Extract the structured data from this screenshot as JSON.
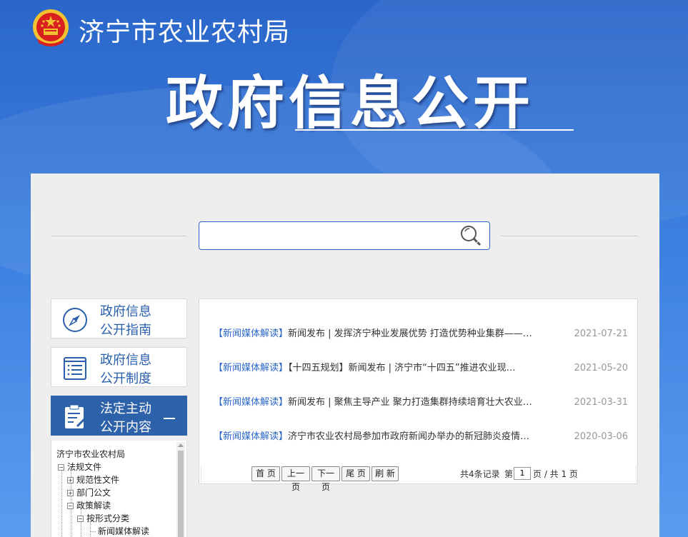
{
  "header": {
    "agency_name": "济宁市农业农村局",
    "page_title": "政府信息公开"
  },
  "search": {
    "placeholder": "",
    "value": ""
  },
  "sidebar": {
    "items": [
      {
        "label_line1": "政府信息",
        "label_line2": "公开指南",
        "icon": "compass-icon",
        "active": false
      },
      {
        "label_line1": "政府信息",
        "label_line2": "公开制度",
        "icon": "list-document-icon",
        "active": false
      },
      {
        "label_line1": "法定主动",
        "label_line2": "公开内容",
        "icon": "clipboard-edit-icon",
        "active": true
      }
    ],
    "tree": {
      "root": "济宁市农业农村局",
      "nodes": [
        {
          "label": "法规文件",
          "toggle": "−"
        },
        {
          "label": "规范性文件",
          "toggle": "+"
        },
        {
          "label": "部门公文",
          "toggle": "+"
        },
        {
          "label": "政策解读",
          "toggle": "−"
        },
        {
          "label": "按形式分类",
          "toggle": "−"
        },
        {
          "label": "新闻媒体解读",
          "toggle": ""
        }
      ]
    }
  },
  "news": {
    "items": [
      {
        "tag": "【新闻媒体解读】",
        "title": "新闻发布 | 发挥济宁种业发展优势 打造优势种业集群——…",
        "date": "2021-07-21"
      },
      {
        "tag": "【新闻媒体解读】",
        "title": "【十四五规划】新闻发布 | 济宁市“十四五”推进农业现…",
        "date": "2021-05-20"
      },
      {
        "tag": "【新闻媒体解读】",
        "title": "新闻发布 | 聚焦主导产业 聚力打造集群持续培育壮大农业…",
        "date": "2021-03-31"
      },
      {
        "tag": "【新闻媒体解读】",
        "title": "济宁市农业农村局参加市政府新闻办举办的新冠肺炎疫情…",
        "date": "2020-03-06"
      }
    ]
  },
  "pager": {
    "first": "首 页",
    "prev": "上一页",
    "next": "下一页",
    "last": "尾 页",
    "refresh": "刷 新",
    "total_text": "共4条记录",
    "page_prefix": "第",
    "page_value": "1",
    "page_suffix": "页 / 共 1 页"
  },
  "colors": {
    "accent": "#2a66c9",
    "active_nav": "#2d62aa",
    "panel_bg": "#eeeeee"
  }
}
